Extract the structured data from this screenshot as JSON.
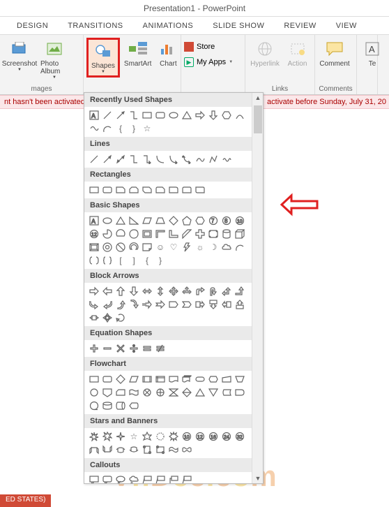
{
  "title": "Presentation1 - PowerPoint",
  "tabs": [
    "DESIGN",
    "TRANSITIONS",
    "ANIMATIONS",
    "SLIDE SHOW",
    "REVIEW",
    "VIEW"
  ],
  "ribbon": {
    "screenshot": "Screenshot",
    "photoalbum": "Photo Album",
    "shapes": "Shapes",
    "smartart": "SmartArt",
    "chart": "Chart",
    "store": "Store",
    "myapps": "My Apps",
    "hyperlink": "Hyperlink",
    "action": "Action",
    "comment": "Comment",
    "text": "Te",
    "group_images": "mages",
    "group_links": "Links",
    "group_comments": "Comments"
  },
  "warning_left": "nt hasn't been activated.",
  "warning_right": "activate before Sunday, July 31, 20",
  "gallery": {
    "sections": [
      "Recently Used Shapes",
      "Lines",
      "Rectangles",
      "Basic Shapes",
      "Block Arrows",
      "Equation Shapes",
      "Flowchart",
      "Stars and Banners",
      "Callouts"
    ]
  },
  "status": "ED STATES)",
  "watermark": "VnDec.com"
}
